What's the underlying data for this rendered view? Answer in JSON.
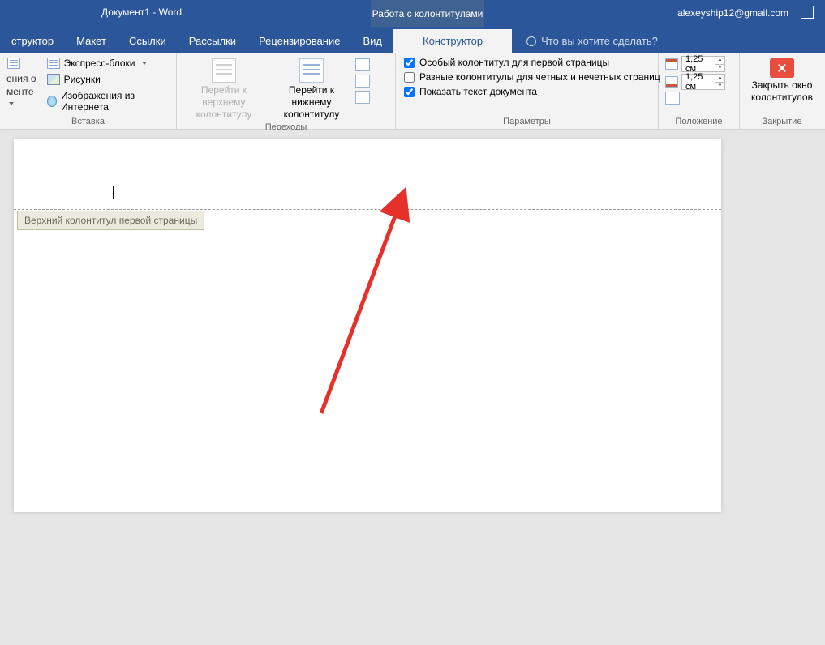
{
  "title": {
    "doc": "Документ1",
    "sep": "  -  ",
    "app": "Word",
    "context": "Работа с колонтитулами",
    "user": "alexeyship12@gmail.com"
  },
  "tabs": {
    "items": [
      "структор",
      "Макет",
      "Ссылки",
      "Рассылки",
      "Рецензирование",
      "Вид"
    ],
    "context_tab": "Конструктор",
    "tellme": "Что вы хотите сделать?"
  },
  "ribbon": {
    "group1": {
      "cutoff_top": "ения о",
      "cutoff_bottom": "менте",
      "express": "Экспресс-блоки",
      "pics": "Рисунки",
      "net": "Изображения из Интернета",
      "label": "Вставка"
    },
    "group2": {
      "goto_top1": "Перейти к верхнему",
      "goto_top2": "колонтитулу",
      "goto_bot1": "Перейти к нижнему",
      "goto_bot2": "колонтитулу",
      "label": "Переходы"
    },
    "group3": {
      "first": "Особый колонтитул для первой страницы",
      "odd": "Разные колонтитулы для четных и нечетных страниц",
      "showtext": "Показать текст документа",
      "label": "Параметры"
    },
    "group4": {
      "top": "1,25 см",
      "bottom": "1,25 см",
      "label": "Положение"
    },
    "group5": {
      "close1": "Закрыть окно",
      "close2": "колонтитулов",
      "label": "Закрытие"
    }
  },
  "doc": {
    "header_tag": "Верхний колонтитул первой страницы"
  }
}
